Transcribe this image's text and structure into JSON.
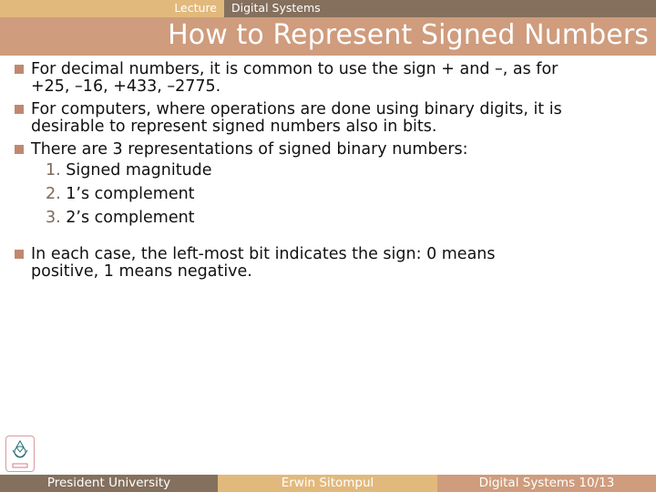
{
  "header": {
    "lecture_label": "Lecture",
    "course": "Digital Systems",
    "title": "How to Represent Signed Numbers"
  },
  "content": {
    "bullets": [
      {
        "line1": "For decimal numbers, it is common to use the sign + and –, as for",
        "line2": "+25, –16, +433, –2775."
      },
      {
        "line1": "For computers, where operations are done using binary digits, it is",
        "line2": "desirable to represent signed numbers also in bits."
      },
      {
        "line1": "There are 3 representations of signed binary numbers:"
      }
    ],
    "sublist": [
      {
        "num": "1.",
        "text": "Signed magnitude"
      },
      {
        "num": "2.",
        "text": "1’s complement"
      },
      {
        "num": "3.",
        "text": "2’s complement"
      }
    ],
    "last_bullet": {
      "line1": "In each case, the left-most bit indicates the sign: 0 means",
      "line2": "positive, 1 means negative."
    }
  },
  "footer": {
    "university": "President University",
    "author": "Erwin Sitompul",
    "course_page": "Digital Systems 10/13"
  },
  "colors": {
    "tan": "#e2b97c",
    "brown": "#85705e",
    "rose": "#cf9c7d",
    "bullet": "#c08870"
  }
}
